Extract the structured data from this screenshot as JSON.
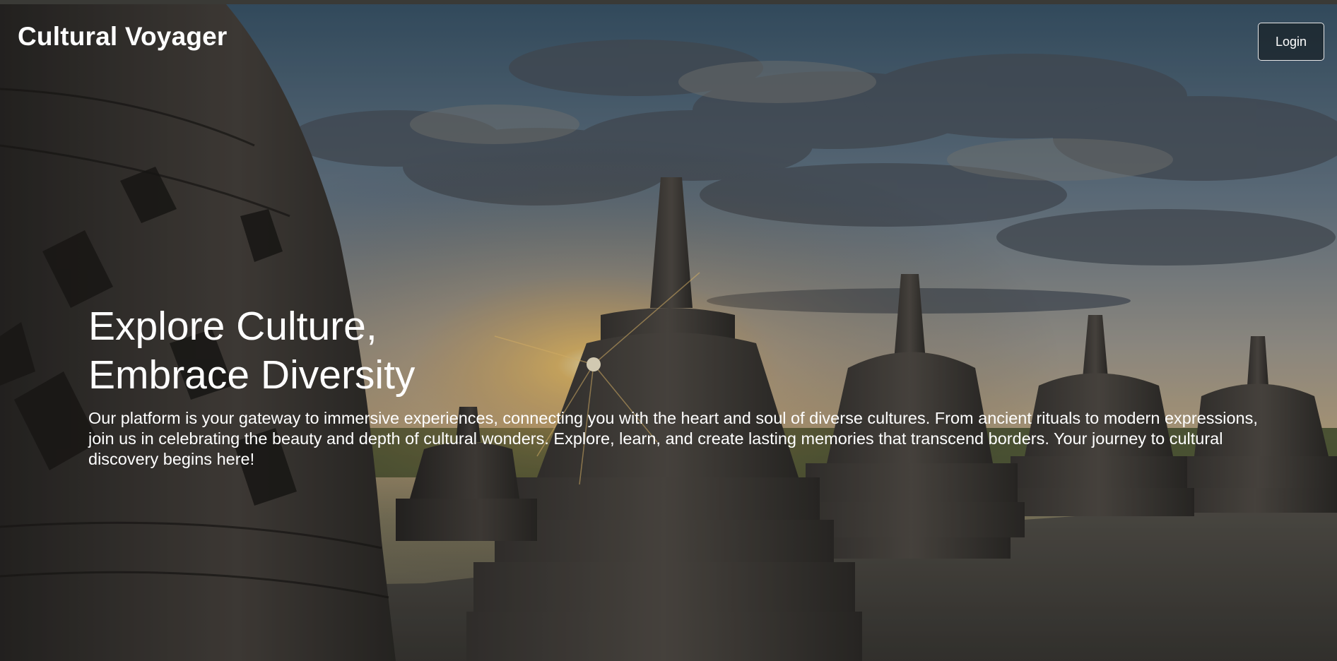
{
  "app": {
    "brand": "Cultural Voyager"
  },
  "header": {
    "login_label": "Login"
  },
  "hero": {
    "title_line1": "Explore Culture,",
    "title_line2": "Embrace Diversity",
    "description": "Our platform is your gateway to immersive experiences, connecting you with the heart and soul of diverse cultures. From ancient rituals to modern expressions, join us in celebrating the beauty and depth of cultural wonders. Explore, learn, and create lasting memories that transcend borders. Your journey to cultural discovery begins here!",
    "background": "temple-stupas-sunset-photo"
  },
  "colors": {
    "text": "#ffffff",
    "button_border": "#e8e8e8"
  }
}
